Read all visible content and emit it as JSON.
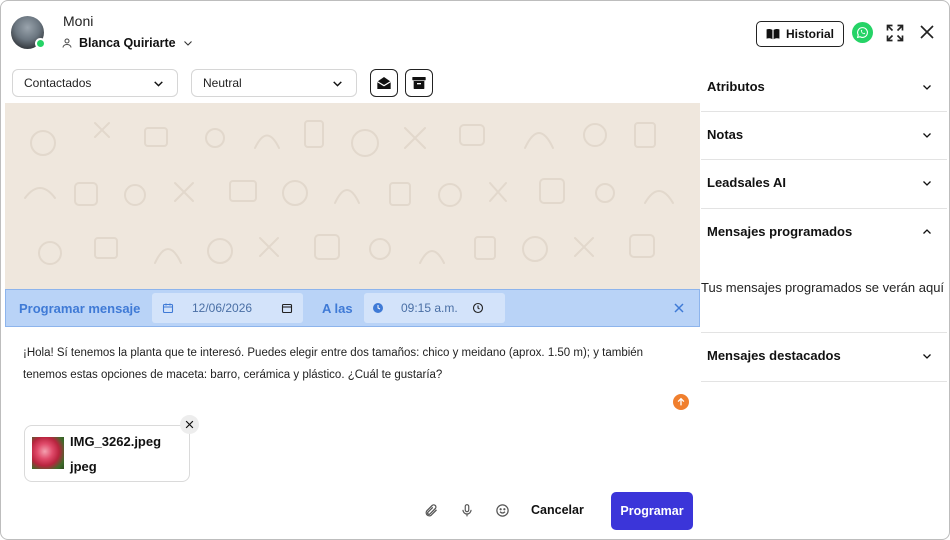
{
  "header": {
    "contact_name": "Moni",
    "agent_name": "Blanca Quiriarte",
    "historial_label": "Historial"
  },
  "filters": {
    "status_value": "Contactados",
    "sentiment_value": "Neutral"
  },
  "schedule": {
    "title": "Programar mensaje",
    "date_value": "12/06/2026",
    "at_label": "A las",
    "time_value": "09:15 a.m."
  },
  "message": {
    "text": "¡Hola! Sí tenemos la planta que te interesó. Puedes elegir entre dos tamaños: chico y meidano (aprox. 1.50 m); y también tenemos estas opciones de maceta: barro, cerámica y plástico. ¿Cuál te gustaría?"
  },
  "attachment": {
    "name": "IMG_3262.jpeg",
    "ext": "jpeg"
  },
  "actions": {
    "cancel_label": "Cancelar",
    "program_label": "Programar"
  },
  "sidebar": {
    "sections": [
      {
        "title": "Atributos",
        "expanded": false
      },
      {
        "title": "Notas",
        "expanded": false
      },
      {
        "title": "Leadsales AI",
        "expanded": false
      },
      {
        "title": "Mensajes programados",
        "expanded": true
      },
      {
        "title": "Mensajes destacados",
        "expanded": false
      }
    ],
    "scheduled_empty": "Tus mensajes programados se verán aquí"
  },
  "colors": {
    "accent_blue": "#3f7ad6",
    "program_button": "#3b35d9",
    "whatsapp_green": "#25d366",
    "send_orange": "#f07f2e",
    "chat_bg": "#efe7dd"
  }
}
